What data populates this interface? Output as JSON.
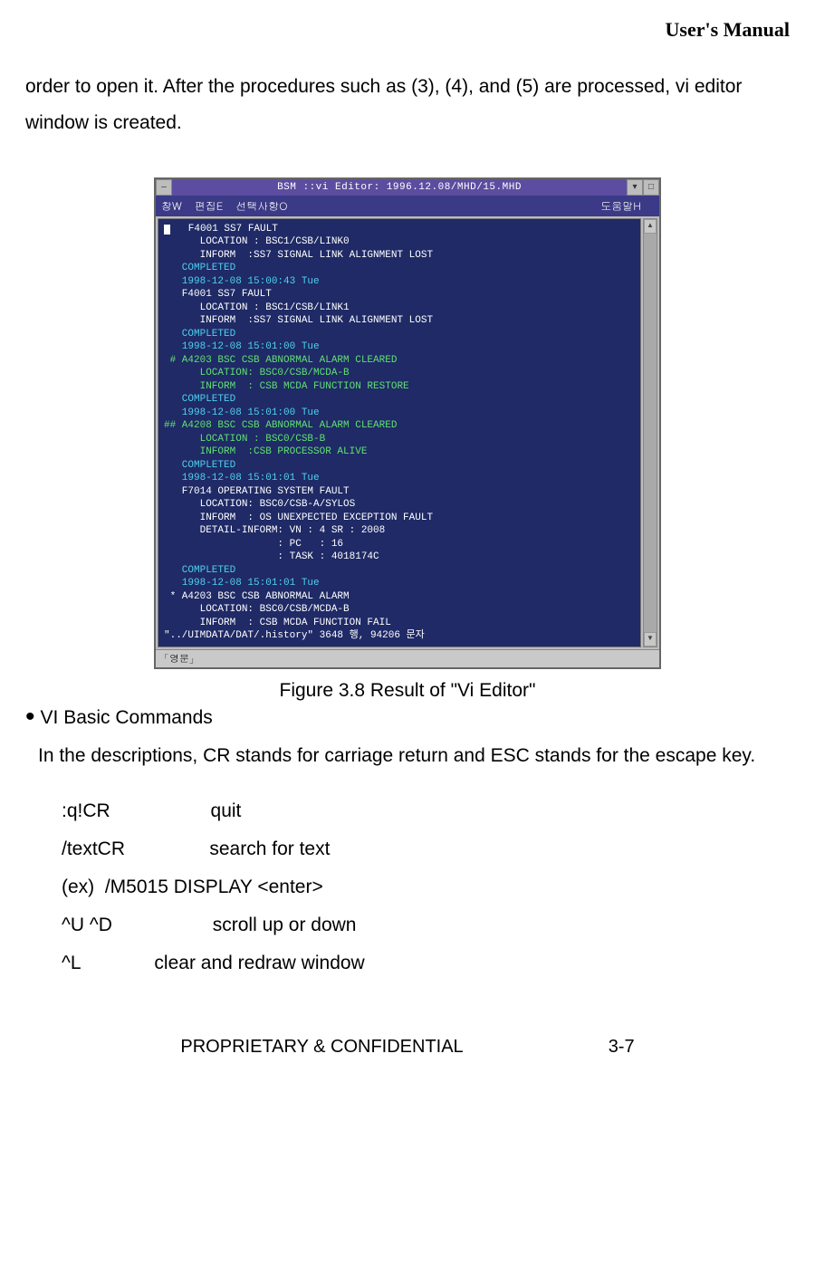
{
  "header": {
    "title": "User's Manual"
  },
  "intro": "order to open it. After the procedures such as (3), (4), and (5) are processed, vi editor window is created.",
  "window": {
    "title": "BSM ::vi Editor: 1996.12.08/MHD/15.MHD",
    "menu": {
      "m1": "창W",
      "m2": "편집E",
      "m3": "선택사항O",
      "help": "도움말H"
    },
    "ime": "「영문」",
    "lines": [
      {
        "cls": "c-white",
        "txt": "   F4001 SS7 FAULT"
      },
      {
        "cls": "c-white",
        "txt": "      LOCATION : BSC1/CSB/LINK0"
      },
      {
        "cls": "c-white",
        "txt": "      INFORM  :SS7 SIGNAL LINK ALIGNMENT LOST"
      },
      {
        "cls": "c-cyan",
        "txt": "   COMPLETED"
      },
      {
        "cls": "c-white",
        "txt": ""
      },
      {
        "cls": "c-cyan",
        "txt": "   1998-12-08 15:00:43 Tue"
      },
      {
        "cls": "c-white",
        "txt": "   F4001 SS7 FAULT"
      },
      {
        "cls": "c-white",
        "txt": "      LOCATION : BSC1/CSB/LINK1"
      },
      {
        "cls": "c-white",
        "txt": "      INFORM  :SS7 SIGNAL LINK ALIGNMENT LOST"
      },
      {
        "cls": "c-cyan",
        "txt": "   COMPLETED"
      },
      {
        "cls": "c-white",
        "txt": ""
      },
      {
        "cls": "c-cyan",
        "txt": "   1998-12-08 15:01:00 Tue"
      },
      {
        "cls": "c-green",
        "txt": " # A4203 BSC CSB ABNORMAL ALARM CLEARED"
      },
      {
        "cls": "c-green",
        "txt": "      LOCATION: BSC0/CSB/MCDA-B"
      },
      {
        "cls": "c-green",
        "txt": "      INFORM  : CSB MCDA FUNCTION RESTORE"
      },
      {
        "cls": "c-cyan",
        "txt": "   COMPLETED"
      },
      {
        "cls": "c-white",
        "txt": ""
      },
      {
        "cls": "c-cyan",
        "txt": "   1998-12-08 15:01:00 Tue"
      },
      {
        "cls": "c-green",
        "txt": "## A4208 BSC CSB ABNORMAL ALARM CLEARED"
      },
      {
        "cls": "c-green",
        "txt": "      LOCATION : BSC0/CSB-B"
      },
      {
        "cls": "c-green",
        "txt": "      INFORM  :CSB PROCESSOR ALIVE"
      },
      {
        "cls": "c-cyan",
        "txt": "   COMPLETED"
      },
      {
        "cls": "c-white",
        "txt": ""
      },
      {
        "cls": "c-cyan",
        "txt": "   1998-12-08 15:01:01 Tue"
      },
      {
        "cls": "c-white",
        "txt": "   F7014 OPERATING SYSTEM FAULT"
      },
      {
        "cls": "c-white",
        "txt": "      LOCATION: BSC0/CSB-A/SYLOS"
      },
      {
        "cls": "c-white",
        "txt": "      INFORM  : OS UNEXPECTED EXCEPTION FAULT"
      },
      {
        "cls": "c-white",
        "txt": "      DETAIL-INFORM: VN : 4 SR : 2008"
      },
      {
        "cls": "c-white",
        "txt": "                   : PC   : 16"
      },
      {
        "cls": "c-white",
        "txt": "                   : TASK : 4018174C"
      },
      {
        "cls": "c-cyan",
        "txt": "   COMPLETED"
      },
      {
        "cls": "c-white",
        "txt": ""
      },
      {
        "cls": "c-cyan",
        "txt": "   1998-12-08 15:01:01 Tue"
      },
      {
        "cls": "c-white",
        "txt": " * A4203 BSC CSB ABNORMAL ALARM"
      },
      {
        "cls": "c-white",
        "txt": "      LOCATION: BSC0/CSB/MCDA-B"
      },
      {
        "cls": "c-white",
        "txt": "      INFORM  : CSB MCDA FUNCTION FAIL"
      },
      {
        "cls": "c-status",
        "txt": "\"../UIMDATA/DAT/.history\" 3648 행, 94206 문자"
      }
    ]
  },
  "caption": "Figure 3.8 Result of \"Vi Editor\"",
  "bullet": "VI Basic Commands",
  "desc": "In the descriptions, CR stands for carriage return and ESC stands for the escape key.",
  "cmds": {
    "r1": ":q!CR                   quit",
    "r2": "/textCR                search for text",
    "r3": "(ex)  /M5015 DISPLAY <enter>",
    "r4": "^U ^D                   scroll up or down",
    "r5": "^L              clear and redraw window"
  },
  "footer": {
    "left": "PROPRIETARY & CONFIDENTIAL",
    "right": "3-7"
  }
}
